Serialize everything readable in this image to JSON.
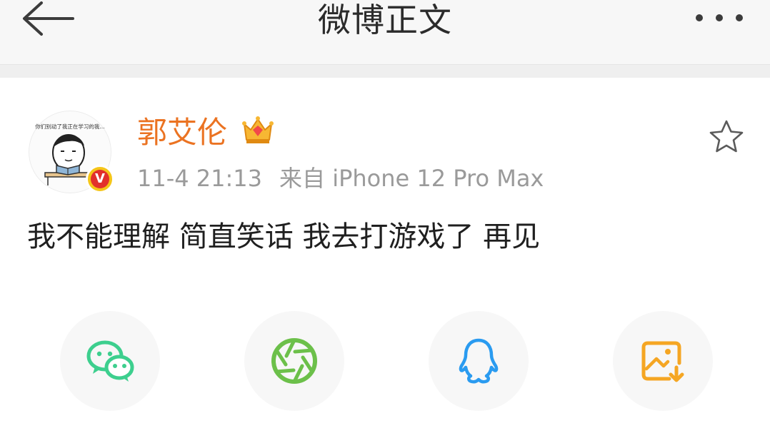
{
  "header": {
    "title": "微博正文",
    "back_icon": "arrow-left-icon",
    "more_icon": "more-dots-icon"
  },
  "post": {
    "avatar_caption": "你们别动了我正在学习的我...",
    "verified_badge": "V",
    "author": "郭艾伦",
    "member_icon": "crown-icon",
    "time": "11-4 21:13",
    "source": "来自 iPhone 12 Pro Max",
    "favorite_icon": "star-outline-icon",
    "text": "我不能理解 简直笑话 我去打游戏了 再见"
  },
  "share": [
    {
      "icon": "wechat-icon",
      "color": "#3dcf8e"
    },
    {
      "icon": "moments-icon",
      "color": "#6cc04a"
    },
    {
      "icon": "qq-icon",
      "color": "#2a9bf0"
    },
    {
      "icon": "save-image-icon",
      "color": "#f5a623"
    }
  ],
  "colors": {
    "author": "#eb7322",
    "meta": "#9a9a9a",
    "header_bg": "#f7f7f7",
    "badge_red": "#e2302b",
    "badge_gold": "#f5c518"
  }
}
